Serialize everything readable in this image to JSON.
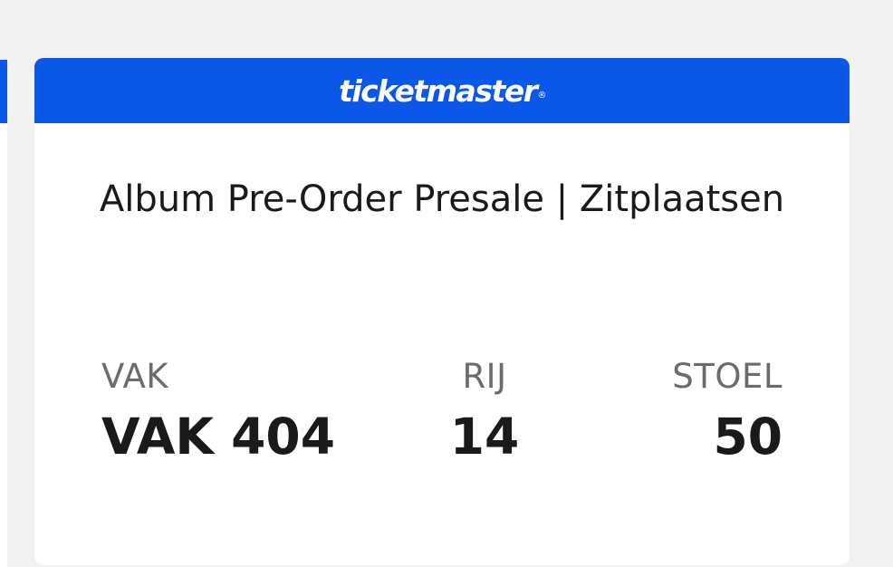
{
  "brand": {
    "name": "ticketmaster",
    "registered_mark": "®",
    "color": "#0a57e8"
  },
  "ticket": {
    "title": "Album Pre-Order Presale | Zitplaatsen",
    "section_label": "VAK",
    "section_value": "VAK 404",
    "row_label": "RIJ",
    "row_value": "14",
    "seat_label": "STOEL",
    "seat_value": "50"
  }
}
